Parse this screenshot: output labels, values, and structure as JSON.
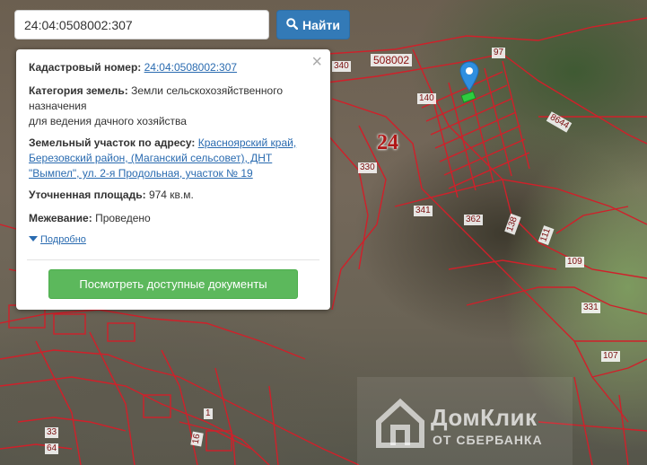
{
  "search": {
    "value": "24:04:0508002:307",
    "button_label": "Найти"
  },
  "panel": {
    "cadastral_label": "Кадастровый номер:",
    "cadastral_value": "24:04:0508002:307",
    "category_label": "Категория земель:",
    "category_value_line1": "Земли сельскохозяйственного",
    "category_value_line2": "назначения",
    "category_value_line3": "для ведения дачного хозяйства",
    "address_label": "Земельный участок по адресу:",
    "address_value_line1": "Красноярский край,",
    "address_value_line2": "Березовский район, (Маганский сельсовет), ДНТ",
    "address_value_line3": "\"Вымпел\", ул. 2-я Продольная, участок № 19",
    "area_label": "Уточненная площадь:",
    "area_value": "974 кв.м.",
    "survey_label": "Межевание:",
    "survey_value": "Проведено",
    "details_label": "Подробно",
    "docs_button_label": "Посмотреть доступные документы",
    "close_glyph": "×"
  },
  "map": {
    "block_number": "508002",
    "district_number": "24",
    "parcels": [
      "97",
      "340",
      "140",
      "8644",
      "330",
      "341",
      "362",
      "138",
      "111",
      "109",
      "331",
      "107",
      "33",
      "64",
      "1",
      "16"
    ]
  },
  "watermark": {
    "title": "ДомКлик",
    "subtitle": "ОТ СБЕРБАНКА"
  },
  "colors": {
    "parcel_outline": "#d0202a",
    "search_button": "#337ab7",
    "docs_button": "#5cb85c",
    "link": "#2a6bb0",
    "pin": "#2f8fe0",
    "selected_parcel": "#2ecc40"
  },
  "icons": {
    "search": "magnifier-icon",
    "pin": "map-pin-icon",
    "details": "triangle-down-icon",
    "close": "close-icon"
  }
}
